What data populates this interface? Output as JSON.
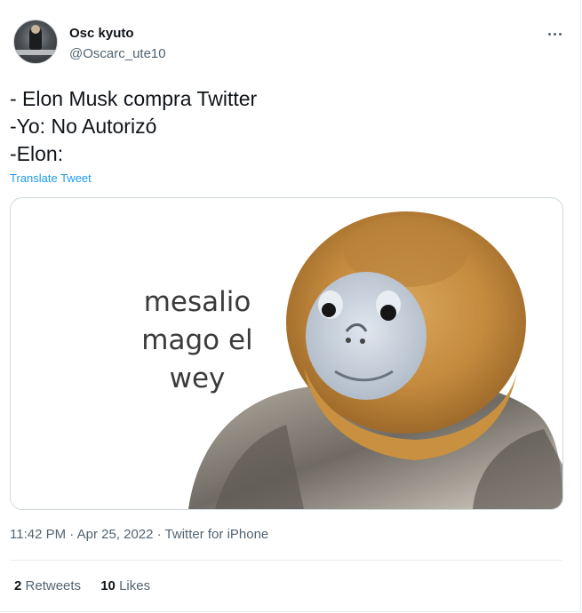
{
  "tweet": {
    "author_name": "Osc kyuto",
    "author_handle": "@Oscarc_ute10",
    "lines": [
      "- Elon Musk compra Twitter",
      "-Yo: No Autorizó",
      "-Elon:"
    ],
    "translate_label": "Translate Tweet",
    "media": {
      "meme_text": [
        "mesalio",
        "mago el",
        "wey"
      ]
    },
    "timestamp": "11:42 PM · Apr 25, 2022 · Twitter for iPhone",
    "stats": {
      "retweets_count": "2",
      "retweets_label": "Retweets",
      "likes_count": "10",
      "likes_label": "Likes"
    }
  },
  "colors": {
    "link": "#1d9bf0",
    "secondary_text": "#536471",
    "primary_text": "#0f1419"
  },
  "icons": [
    "more-options-icon"
  ]
}
